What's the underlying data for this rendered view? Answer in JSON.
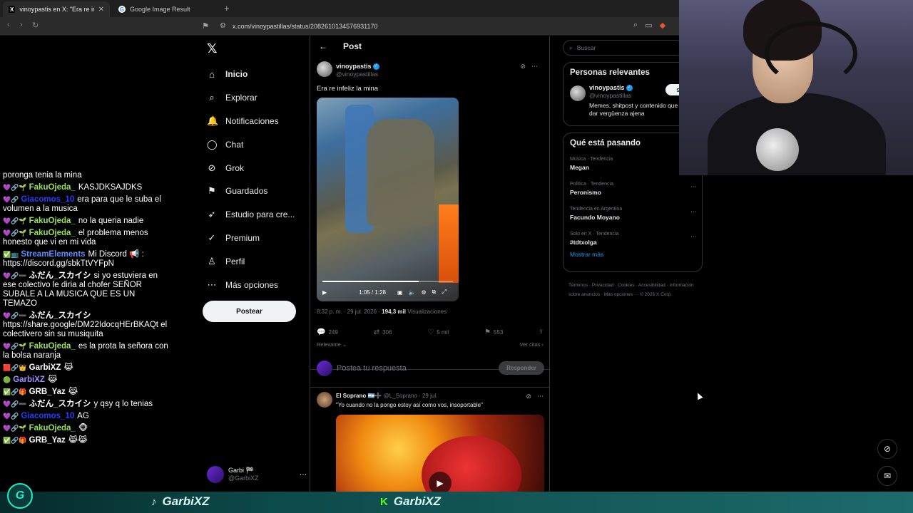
{
  "browser": {
    "tabs": [
      {
        "title": "vinoypastis en X: \"Era re infeliz la",
        "icon": "X"
      },
      {
        "title": "Google Image Result",
        "icon": "G"
      }
    ],
    "url": "x.com/vinoypastillas/status/2082610134576931170"
  },
  "chat": [
    {
      "badges": "",
      "user": "",
      "text": "poronga tenia la mina",
      "color": "#fff"
    },
    {
      "badges": "💜🔗🌱",
      "user": "FakuOjeda_",
      "text": "KASJDKSAJDKS",
      "color": "#9adf5a"
    },
    {
      "badges": "💜🔗",
      "user": "Giacomos_10",
      "text": "era para que le suba el volumen a la musica",
      "color": "#2b3cff"
    },
    {
      "badges": "💜🔗🌱",
      "user": "FakuOjeda_",
      "text": "no la queria nadie",
      "color": "#9adf5a"
    },
    {
      "badges": "💜🔗🌱",
      "user": "FakuOjeda_",
      "text": "el problema menos honesto que vi en mi vida",
      "color": "#9adf5a"
    },
    {
      "badges": "✅📺",
      "user": "StreamElements",
      "text": "Mi Discord 📢 : https://discord.gg/sbkTtVYFpN",
      "color": "#5b8cff"
    },
    {
      "badges": "💜🔗➖",
      "user": "ふだん_スカイシ",
      "text": "si yo estuviera en ese colectivo le diria al chofer SEÑOR SUBALE A LA MUSICA QUE ES UN TEMAZO",
      "color": "#fff"
    },
    {
      "badges": "💜🔗➖",
      "user": "ふだん_スカイシ",
      "text": "https://share.google/DM22IdocqHErBKAQt el colectivero sin su musiquita",
      "color": "#fff"
    },
    {
      "badges": "💜🔗🌱",
      "user": "FakuOjeda_",
      "text": "es la prota la señora con la bolsa naranja",
      "color": "#9adf5a"
    },
    {
      "badges": "🟥🔗👑",
      "user": "GarbiXZ",
      "text": "😹",
      "color": "#fff"
    },
    {
      "badges": "🟢",
      "user": "GarbiXZ",
      "text": "😹",
      "color": "#a68cff"
    },
    {
      "badges": "✅🔗🎁",
      "user": "GRB_Yaz",
      "text": "😹",
      "color": "#fff"
    },
    {
      "badges": "💜🔗➖",
      "user": "ふだん_スカイシ",
      "text": "y qsy q lo tenias",
      "color": "#fff"
    },
    {
      "badges": "💜🔗",
      "user": "Giacomos_10",
      "text": "AG",
      "color": "#2b3cff"
    },
    {
      "badges": "💜🔗🌱",
      "user": "FakuOjeda_",
      "text": "🐵",
      "color": "#9adf5a"
    },
    {
      "badges": "✅🔗🎁",
      "user": "GRB_Yaz",
      "text": "😹😹",
      "color": "#fff"
    }
  ],
  "nav": {
    "items": [
      {
        "label": "Inicio",
        "icon": "⌂",
        "bold": true
      },
      {
        "label": "Explorar",
        "icon": "⌕"
      },
      {
        "label": "Notificaciones",
        "icon": "🔔"
      },
      {
        "label": "Chat",
        "icon": "◯"
      },
      {
        "label": "Grok",
        "icon": "⊘"
      },
      {
        "label": "Guardados",
        "icon": "⚑"
      },
      {
        "label": "Estudio para cre...",
        "icon": "➶"
      },
      {
        "label": "Premium",
        "icon": "✓"
      },
      {
        "label": "Perfil",
        "icon": "♙"
      },
      {
        "label": "Más opciones",
        "icon": "⋯"
      }
    ],
    "post_button": "Postear",
    "account": {
      "name": "Garbi 🏁",
      "handle": "@GarbiXZ"
    }
  },
  "main": {
    "title": "Post",
    "tweet": {
      "name": "vinoypastis",
      "handle": "@vinoypastillas",
      "text": "Era re infeliz la mina",
      "video_time": "1:05 / 1:28",
      "video_progress": 0.74,
      "date": "8:32 p. m. · 29 jul. 2026 · ",
      "views_count": "194,3 mil",
      "views_label": " Visualizaciones",
      "replies": "249",
      "reposts": "306",
      "likes": "5 mil",
      "bookmarks": "553",
      "sort_label": "Relevante",
      "quotes_label": "Ver citas"
    },
    "reply_box": {
      "placeholder": "Postea tu respuesta",
      "button": "Responder"
    },
    "reply": {
      "name": "El Soprano 🇦🇷➕",
      "handle": "@L_Soprano · 29 jul.",
      "text": "\"Yo cuando no la pongo estoy así como vos, insoportable\""
    }
  },
  "right": {
    "search_placeholder": "Buscar",
    "relevant_title": "Personas relevantes",
    "relevant_user": {
      "name": "vinoypastis",
      "handle": "@vinoypastillas",
      "bio": "Memes, shitpost y contenido que a dar vergüenza ajena",
      "follow": "Se"
    },
    "trends_title": "Qué está pasando",
    "trends": [
      {
        "category": "Música · Tendencia",
        "name": "Megan"
      },
      {
        "category": "Política · Tendencia",
        "name": "Peronismo"
      },
      {
        "category": "Tendencia en Argentina",
        "name": "Facundo Moyano"
      },
      {
        "category": "Solo en X · Tendencia",
        "name": "#tdtxolga"
      }
    ],
    "show_more": "Mostrar más",
    "footer": "Términos · Privacidad · Cookies · Accesibilidad · Información sobre anuncios · Más opciones ··· © 2026 X Corp."
  },
  "bottom": {
    "logo": "G",
    "tiktok": "GarbiXZ",
    "kick": "GarbiXZ"
  }
}
